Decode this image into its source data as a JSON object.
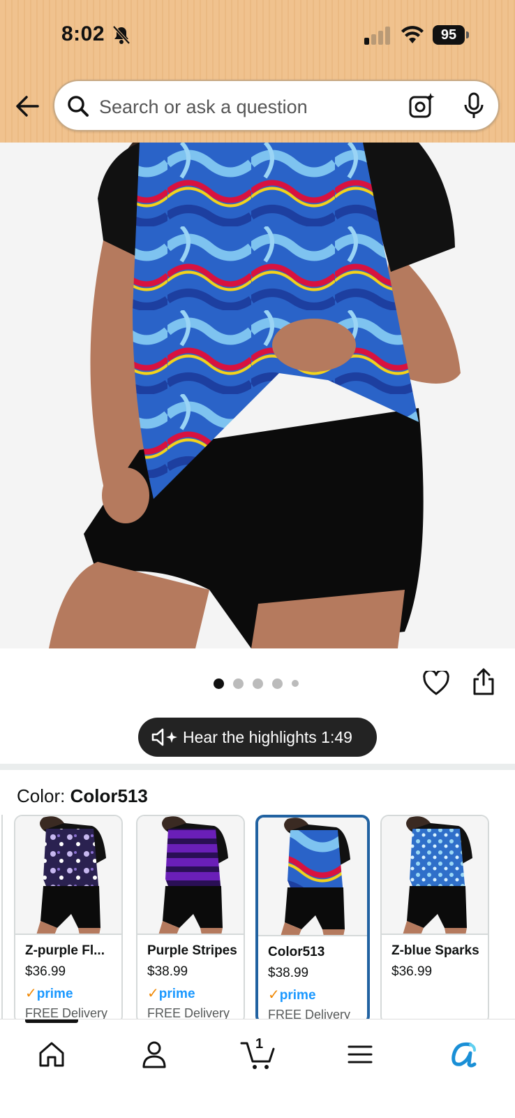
{
  "status_bar": {
    "time": "8:02",
    "battery": "95",
    "icons": [
      "bell-muted-icon",
      "cellular-signal-icon",
      "wifi-icon",
      "battery-icon"
    ]
  },
  "header": {
    "search_placeholder": "Search or ask a question",
    "icons": [
      "back-arrow-icon",
      "search-icon",
      "camera-lens-icon",
      "microphone-icon"
    ],
    "background_color": "#f0c28e"
  },
  "gallery": {
    "image_count": 5,
    "active_index": 0,
    "icons": [
      "heart-icon",
      "share-icon"
    ]
  },
  "highlights_button": {
    "label": "Hear the highlights 1:49",
    "icon": "speaker-sparkle-icon"
  },
  "color_selector": {
    "label": "Color: ",
    "selected": "Color513",
    "options": [
      {
        "name": "Z-purple Fl...",
        "price": "$36.99",
        "prime": "prime",
        "delivery": "FREE Delivery",
        "pattern": "purple-floral"
      },
      {
        "name": "Purple Stripes",
        "price": "$38.99",
        "prime": "prime",
        "delivery": "FREE Delivery",
        "pattern": "purple-stripes"
      },
      {
        "name": "Color513",
        "price": "$38.99",
        "prime": "prime",
        "delivery": "FREE Delivery",
        "pattern": "blue-swirl",
        "selected": true
      },
      {
        "name": "Z-blue Sparks",
        "price": "$36.99",
        "prime": "",
        "delivery": "",
        "pattern": "blue-sparks"
      }
    ],
    "accent_color": "#2162a1"
  },
  "bottom_nav": {
    "items": [
      "home-icon",
      "account-icon",
      "cart-icon",
      "menu-icon",
      "rufus-icon"
    ],
    "cart_count": "1"
  }
}
